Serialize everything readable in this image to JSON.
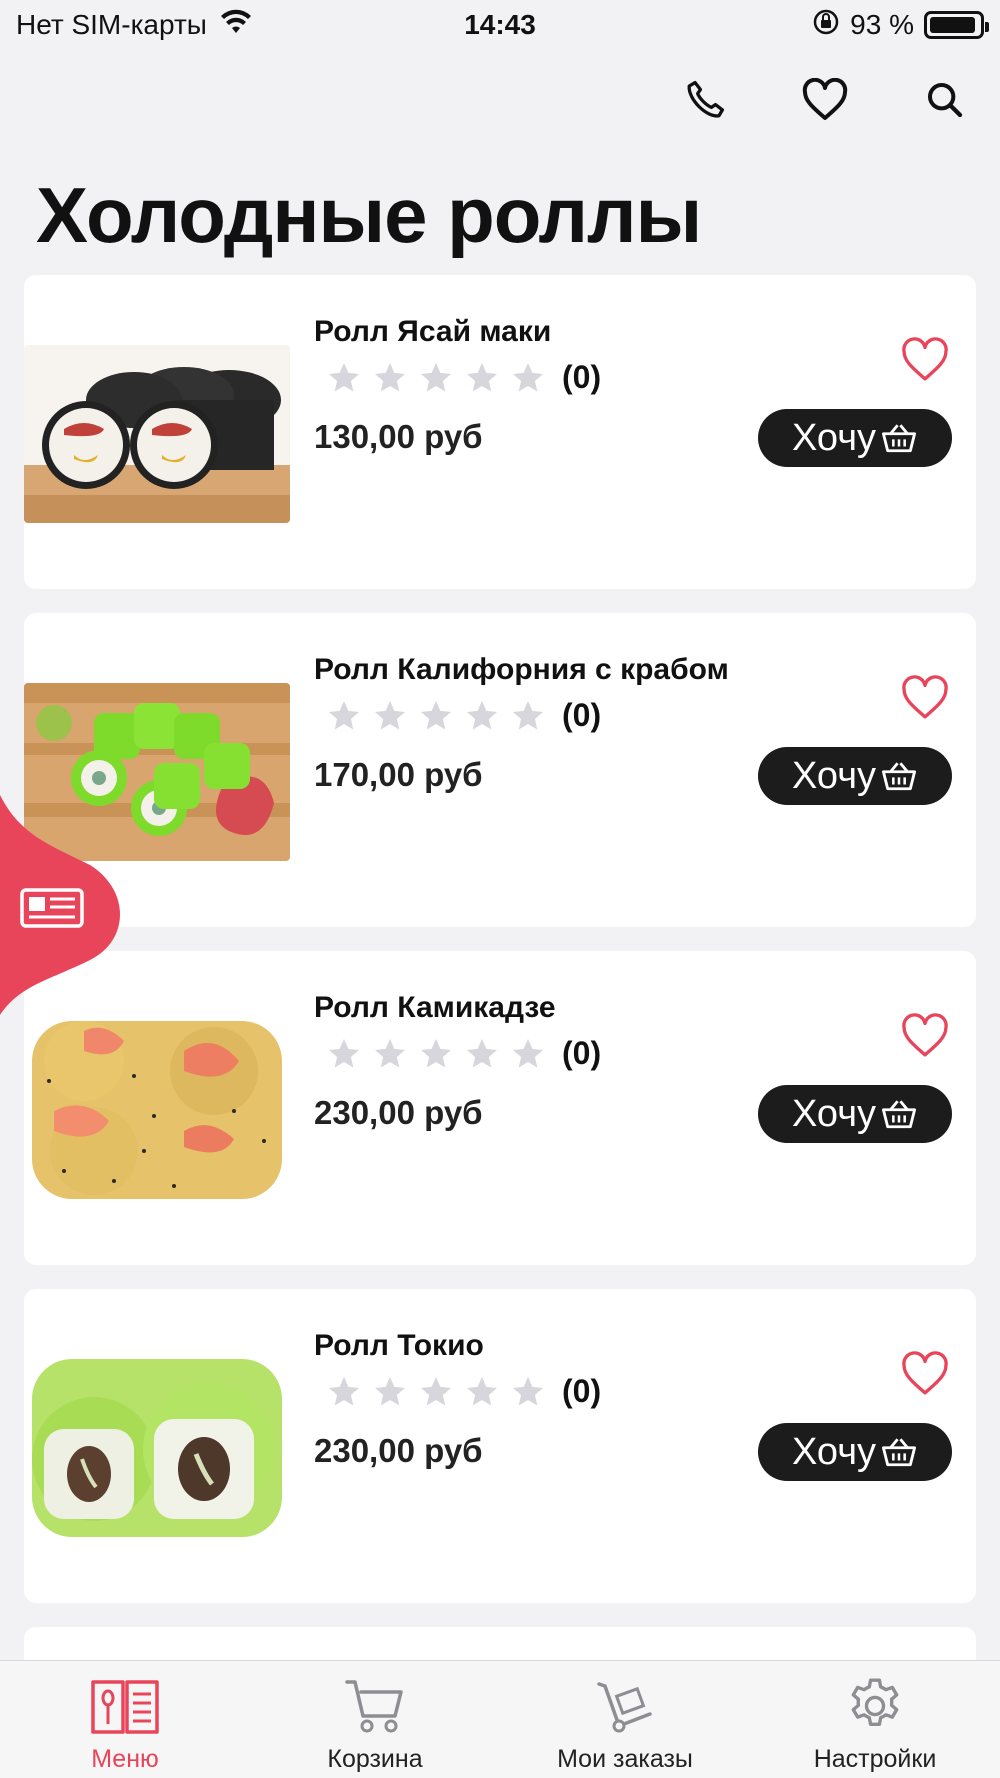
{
  "status_bar": {
    "carrier": "Нет SIM-карты",
    "time": "14:43",
    "battery": "93 %",
    "battery_level": 0.93
  },
  "top_actions": [
    {
      "icon": "phone-icon"
    },
    {
      "icon": "heart-icon"
    },
    {
      "icon": "search-icon"
    }
  ],
  "page": {
    "title": "Холодные роллы"
  },
  "colors": {
    "accent": "#e8455a",
    "button_bg": "#1c1c1c",
    "star_empty": "#d6d6dc"
  },
  "products": [
    {
      "name": "Ролл Ясай маки",
      "rating_count": "(0)",
      "price": "130,00 руб",
      "button_label": "Хочу",
      "image": "sushi-roll-yasai-maki"
    },
    {
      "name": "Ролл Калифорния с крабом",
      "rating_count": "(0)",
      "price": "170,00 руб",
      "button_label": "Хочу",
      "image": "sushi-roll-california-crab"
    },
    {
      "name": "Ролл Камикадзе",
      "rating_count": "(0)",
      "price": "230,00 руб",
      "button_label": "Хочу",
      "image": "sushi-roll-kamikadze"
    },
    {
      "name": "Ролл Токио",
      "rating_count": "(0)",
      "price": "230,00 руб",
      "button_label": "Хочу",
      "image": "sushi-roll-tokio"
    }
  ],
  "tabs": [
    {
      "label": "Меню",
      "icon": "menu-book-icon",
      "active": true
    },
    {
      "label": "Корзина",
      "icon": "cart-icon",
      "active": false
    },
    {
      "label": "Мои заказы",
      "icon": "orders-dolly-icon",
      "active": false
    },
    {
      "label": "Настройки",
      "icon": "gear-icon",
      "active": false
    }
  ]
}
